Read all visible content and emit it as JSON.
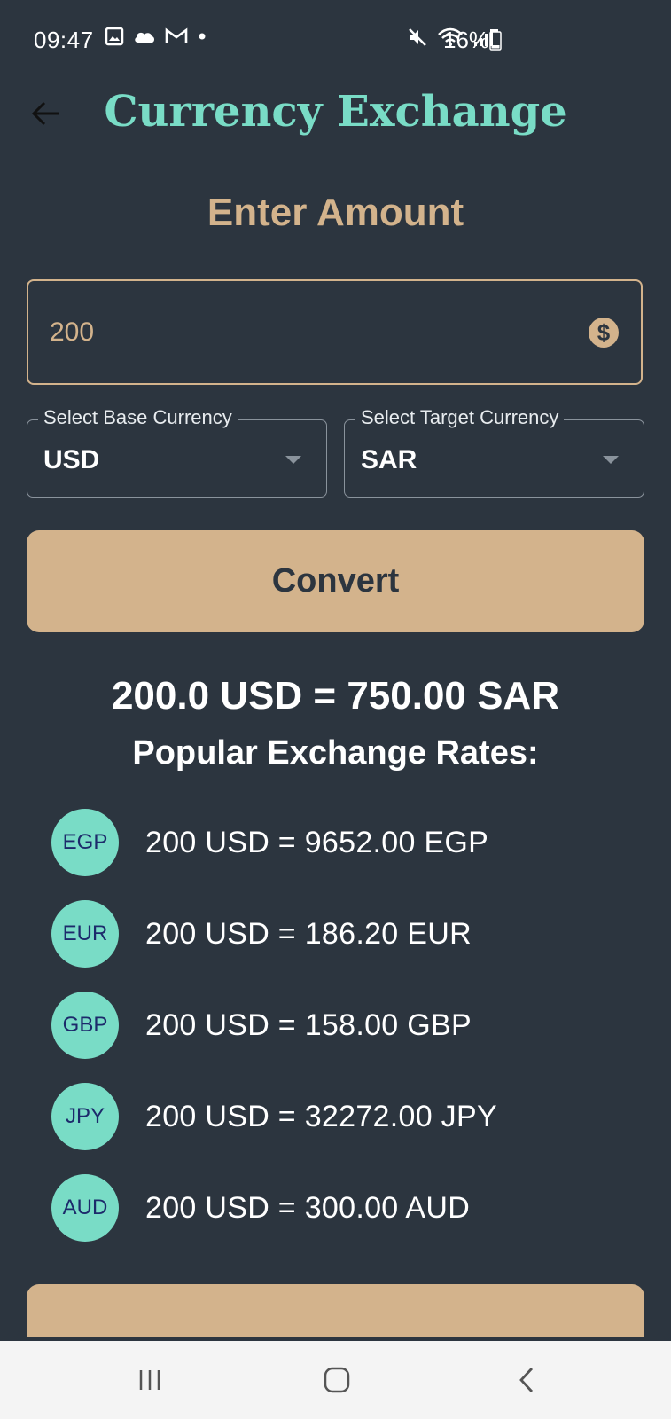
{
  "status_bar": {
    "time": "09:47",
    "battery": "16%",
    "left_icons": [
      "image-icon",
      "cloud-icon",
      "gmail-icon",
      "dot-icon"
    ],
    "right_icons": [
      "mute-icon",
      "wifi-icon",
      "signal-icon",
      "battery-icon"
    ]
  },
  "header": {
    "title": "Currency Exchange",
    "back_icon": "arrow-left-icon"
  },
  "amount": {
    "heading": "Enter Amount",
    "value": "200",
    "icon": "dollar-circle-icon"
  },
  "base_currency": {
    "label": "Select Base Currency",
    "value": "USD"
  },
  "target_currency": {
    "label": "Select Target Currency",
    "value": "SAR"
  },
  "convert_label": "Convert",
  "result_text": "200.0 USD = 750.00 SAR",
  "popular": {
    "title": "Popular Exchange Rates:",
    "items": [
      {
        "code": "EGP",
        "text": "200 USD = 9652.00 EGP"
      },
      {
        "code": "EUR",
        "text": "200 USD = 186.20 EUR"
      },
      {
        "code": "GBP",
        "text": "200 USD = 158.00 GBP"
      },
      {
        "code": "JPY",
        "text": "200 USD = 32272.00 JPY"
      },
      {
        "code": "AUD",
        "text": "200 USD = 300.00 AUD"
      }
    ]
  },
  "nav": {
    "recents": "recents-icon",
    "home": "home-icon",
    "back": "back-icon"
  },
  "colors": {
    "background": "#2c353f",
    "accent_teal": "#79dcc6",
    "accent_tan": "#d3b38c"
  }
}
